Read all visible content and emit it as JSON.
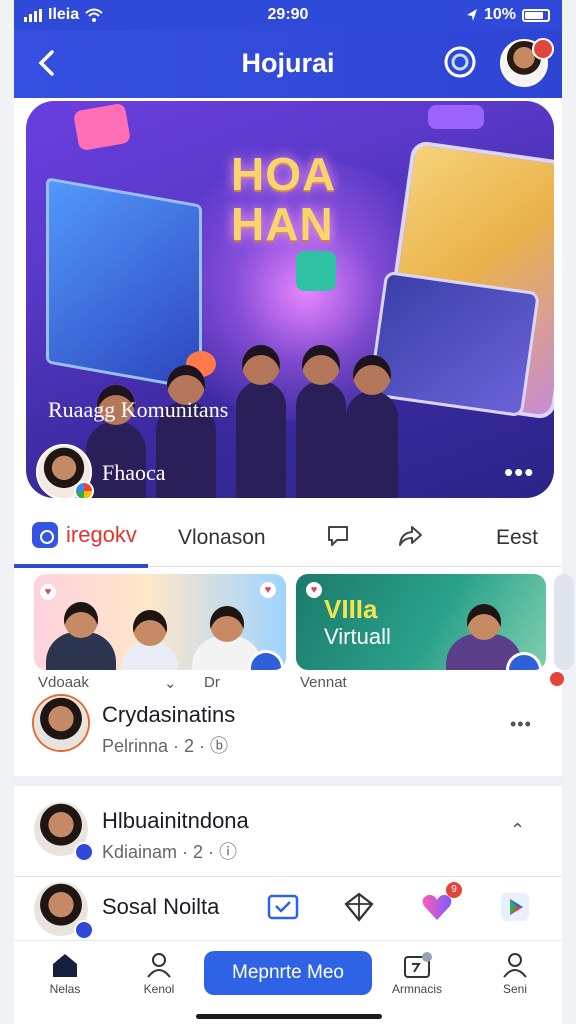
{
  "status_bar": {
    "carrier": "Ileia",
    "time": "29:90",
    "battery": "10%"
  },
  "header": {
    "title": "Hojurai",
    "back_icon": "chevron-left-icon",
    "action_icon": "globe-chat-icon"
  },
  "hero": {
    "headline_line1": "HOA",
    "headline_line2": "HAN",
    "caption": "Ruaagg Komunitans",
    "user_name": "Fhaoca",
    "more_label": "•••"
  },
  "tabs": {
    "active": "iregokv",
    "second": "Vlonason",
    "last": "Eest"
  },
  "cards": [
    {
      "caption": "Vdoaak",
      "caption_mid": "⌄",
      "caption_end": "Dr"
    },
    {
      "title_line1": "VIIIa",
      "title_line2": "Virtuall",
      "caption": "Vennat"
    }
  ],
  "posts": [
    {
      "name": "Crydasinatins",
      "meta": "Pelrinna · 2 · ⓑ",
      "more": "•••"
    },
    {
      "name": "Hlbuainitndona",
      "meta": "Kdiainam · 2 · ⓘ",
      "more": "⌃"
    },
    {
      "name": "Sosal Noilta"
    }
  ],
  "notification_count": "9",
  "bottom_nav": {
    "home": "Nelas",
    "profile": "Kenol",
    "cta": "Mepnrte Meo",
    "activity": "Armnacis",
    "account": "Seni"
  },
  "colors": {
    "primary": "#2f49d8",
    "accent_red": "#e0352b",
    "cta": "#2f63e6"
  }
}
